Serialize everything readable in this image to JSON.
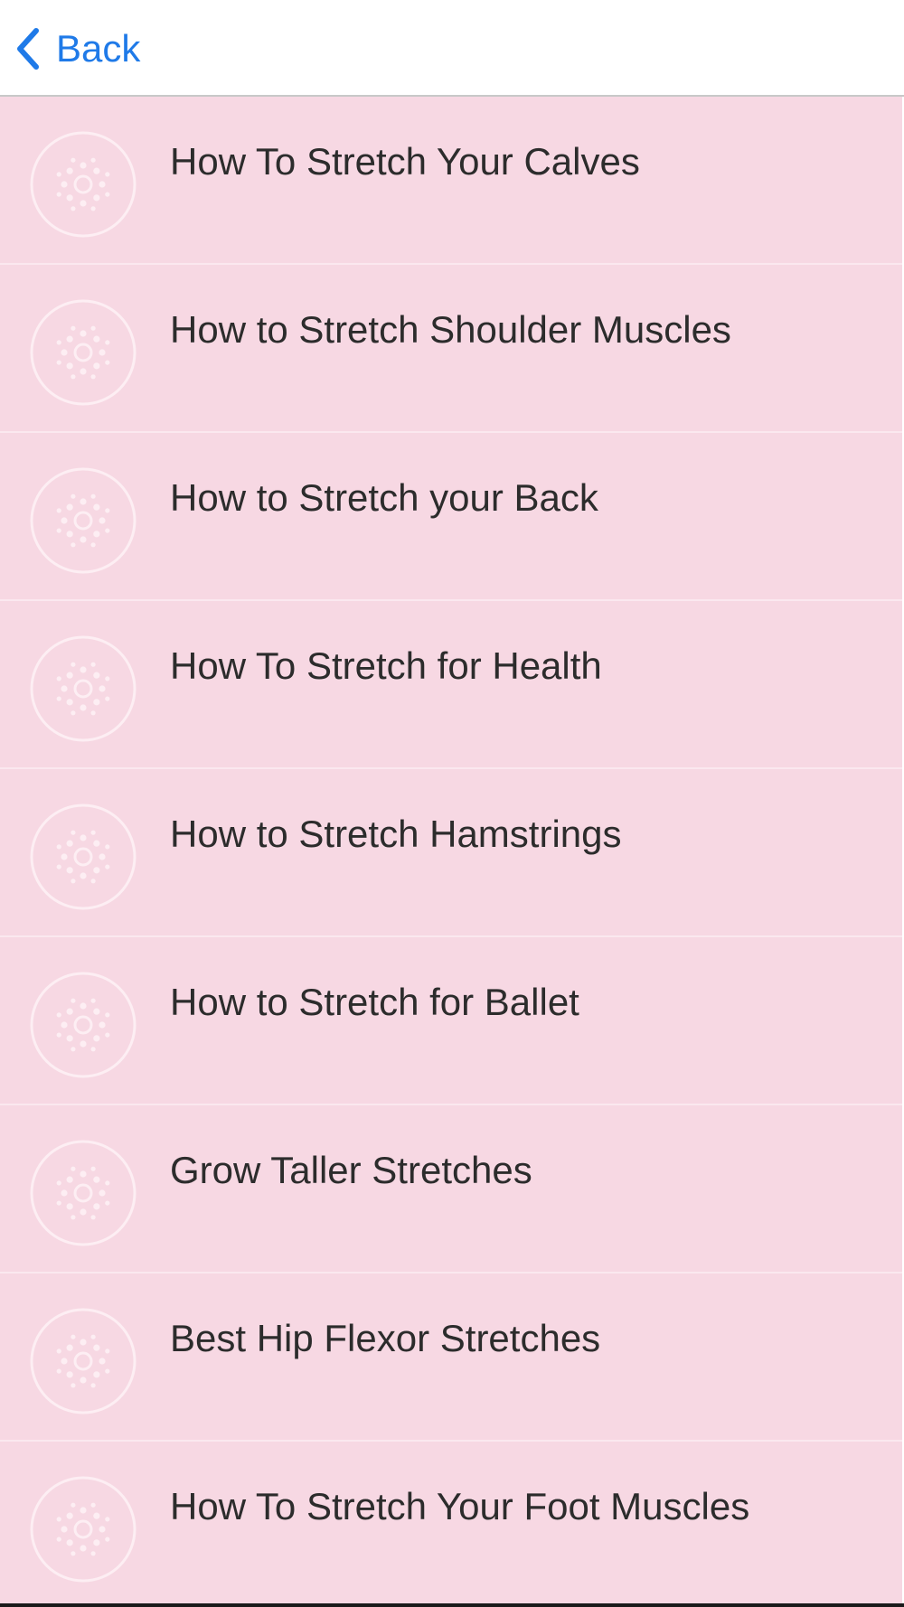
{
  "header": {
    "back_label": "Back",
    "back_icon": "chevron-left-icon",
    "accent_color": "#1f7ae8"
  },
  "list": {
    "background_color": "#f7d8e3",
    "item_icon": "flower-dots-icon",
    "items": [
      {
        "label": "How To Stretch Your Calves"
      },
      {
        "label": "How to Stretch Shoulder Muscles"
      },
      {
        "label": "How to Stretch your Back"
      },
      {
        "label": "How To Stretch for Health"
      },
      {
        "label": "How to Stretch Hamstrings"
      },
      {
        "label": "How to Stretch for Ballet"
      },
      {
        "label": "Grow Taller Stretches"
      },
      {
        "label": "Best Hip Flexor Stretches"
      },
      {
        "label": "How To Stretch Your Foot Muscles"
      }
    ]
  }
}
